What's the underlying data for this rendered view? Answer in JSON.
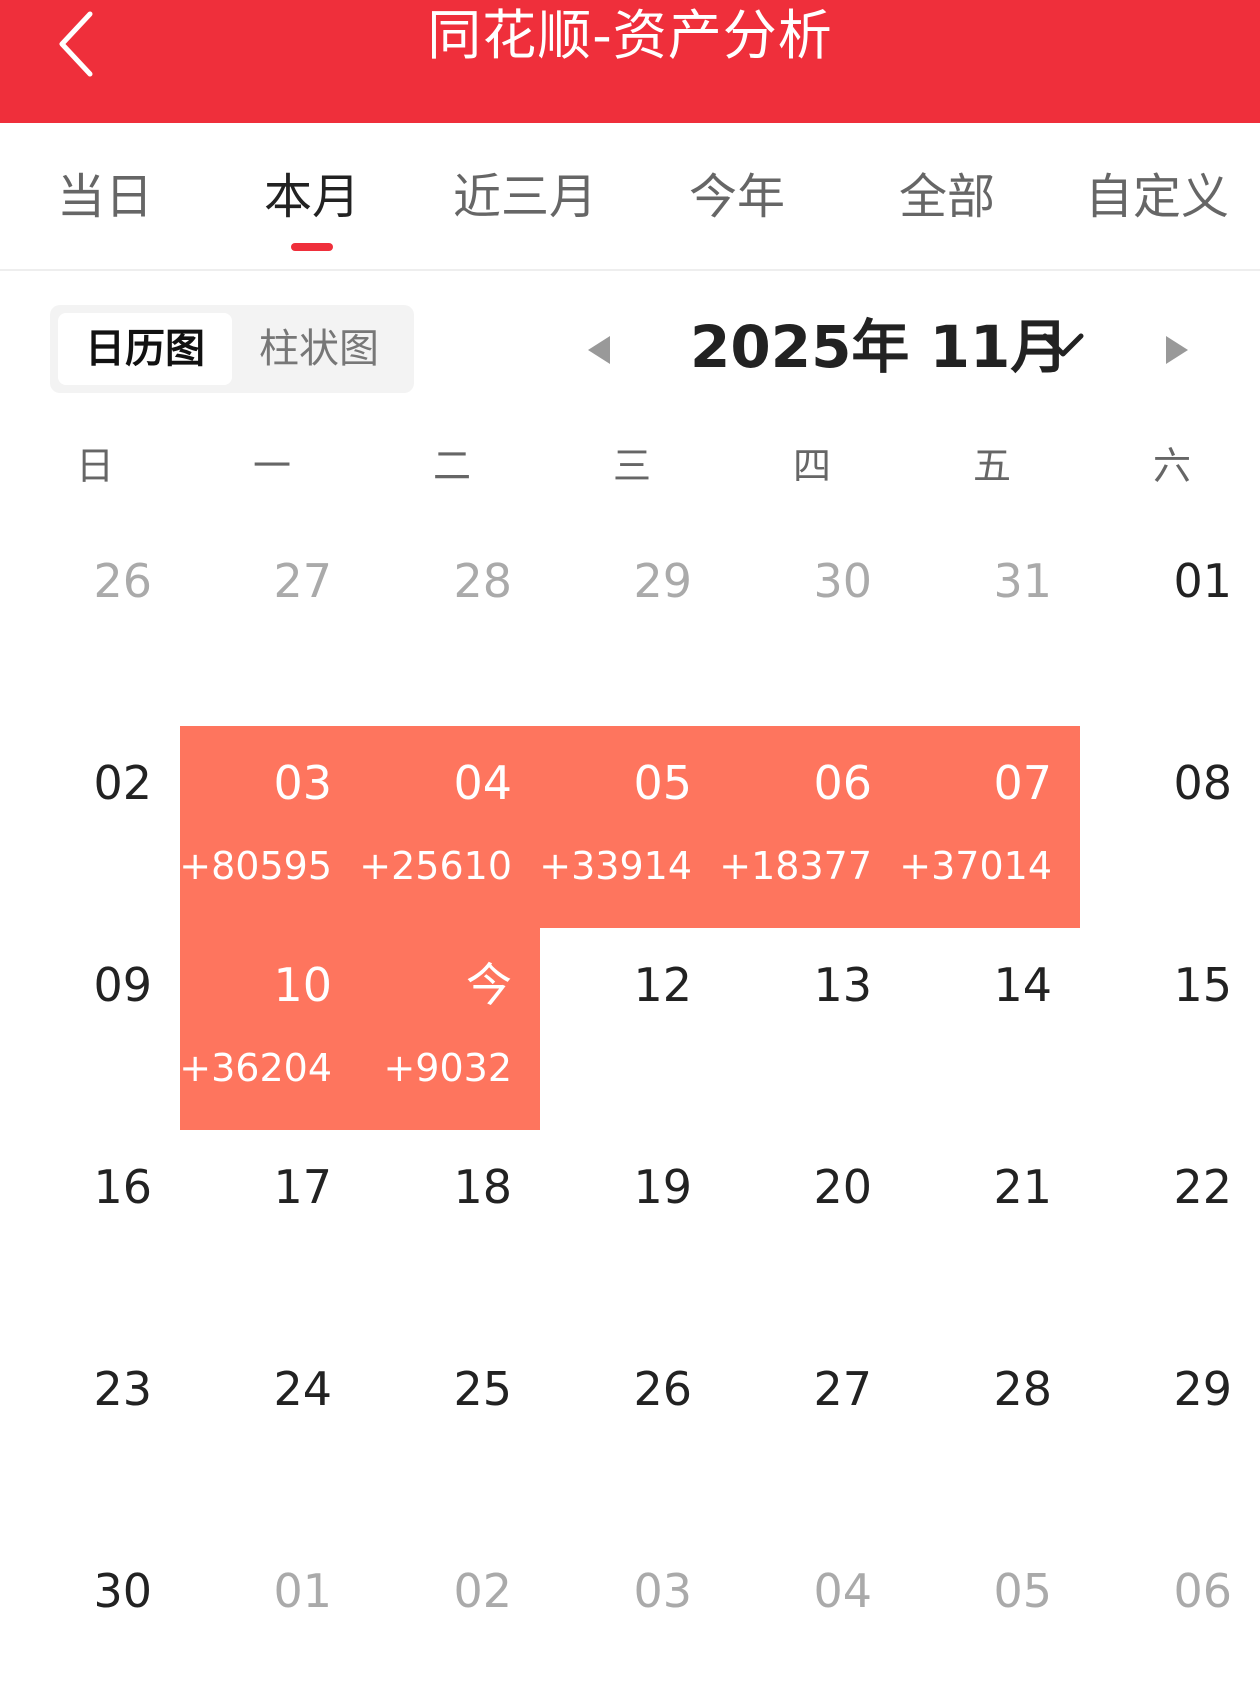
{
  "header": {
    "title": "同花顺-资产分析",
    "back_icon": "chevron-left-icon",
    "background_color": "#ef2f3b"
  },
  "tabs": [
    {
      "label": "当日",
      "active": false
    },
    {
      "label": "本月",
      "active": true
    },
    {
      "label": "近三月",
      "active": false
    },
    {
      "label": "今年",
      "active": false
    },
    {
      "label": "全部",
      "active": false
    },
    {
      "label": "自定义",
      "active": false
    }
  ],
  "view_toggle": {
    "calendar_label": "日历图",
    "bar_label": "柱状图",
    "selected": "日历图"
  },
  "month_nav": {
    "label": "2025年 11月",
    "prev_icon": "triangle-left-icon",
    "next_icon": "triangle-right-icon",
    "dropdown_icon": "chevron-down-icon"
  },
  "weekdays": [
    "日",
    "一",
    "二",
    "三",
    "四",
    "五",
    "六"
  ],
  "calendar": {
    "profit_color": "#fe755e",
    "weeks": [
      [
        {
          "day": "26",
          "other": true
        },
        {
          "day": "27",
          "other": true
        },
        {
          "day": "28",
          "other": true
        },
        {
          "day": "29",
          "other": true
        },
        {
          "day": "30",
          "other": true
        },
        {
          "day": "31",
          "other": true
        },
        {
          "day": "01"
        }
      ],
      [
        {
          "day": "02"
        },
        {
          "day": "03",
          "profit": "+80595"
        },
        {
          "day": "04",
          "profit": "+25610"
        },
        {
          "day": "05",
          "profit": "+33914"
        },
        {
          "day": "06",
          "profit": "+18377"
        },
        {
          "day": "07",
          "profit": "+37014"
        },
        {
          "day": "08"
        }
      ],
      [
        {
          "day": "09"
        },
        {
          "day": "10",
          "profit": "+36204"
        },
        {
          "day": "今",
          "profit": "+9032"
        },
        {
          "day": "12"
        },
        {
          "day": "13"
        },
        {
          "day": "14"
        },
        {
          "day": "15"
        }
      ],
      [
        {
          "day": "16"
        },
        {
          "day": "17"
        },
        {
          "day": "18"
        },
        {
          "day": "19"
        },
        {
          "day": "20"
        },
        {
          "day": "21"
        },
        {
          "day": "22"
        }
      ],
      [
        {
          "day": "23"
        },
        {
          "day": "24"
        },
        {
          "day": "25"
        },
        {
          "day": "26"
        },
        {
          "day": "27"
        },
        {
          "day": "28"
        },
        {
          "day": "29"
        }
      ],
      [
        {
          "day": "30"
        },
        {
          "day": "01",
          "other": true
        },
        {
          "day": "02",
          "other": true
        },
        {
          "day": "03",
          "other": true
        },
        {
          "day": "04",
          "other": true
        },
        {
          "day": "05",
          "other": true
        },
        {
          "day": "06",
          "other": true
        }
      ]
    ]
  }
}
